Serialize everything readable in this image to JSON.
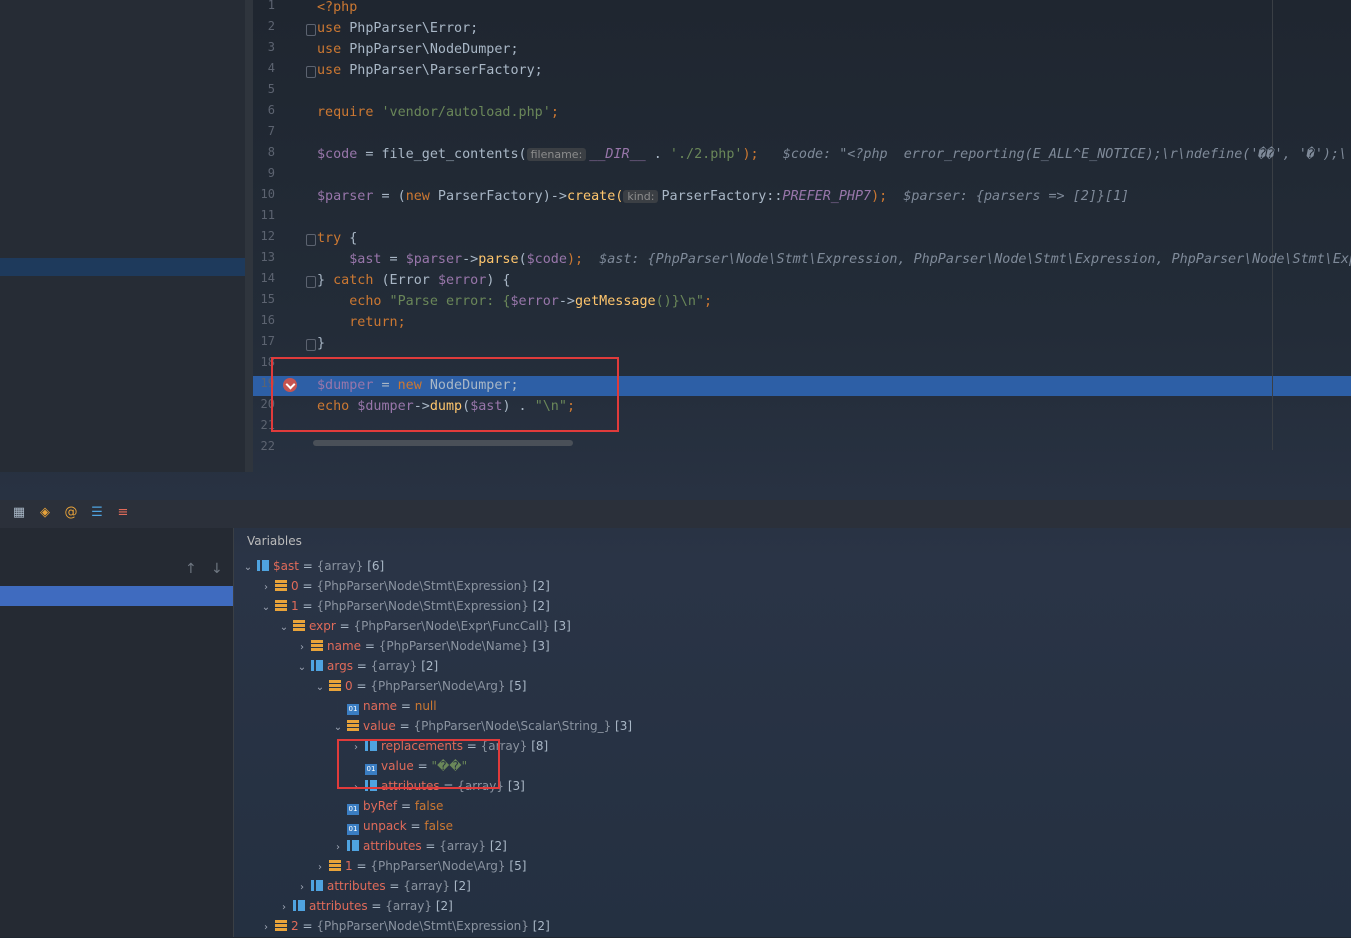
{
  "editor": {
    "line_numbers": [
      "1",
      "2",
      "3",
      "4",
      "5",
      "6",
      "7",
      "8",
      "9",
      "10",
      "11",
      "12",
      "13",
      "14",
      "15",
      "16",
      "17",
      "18",
      "19",
      "20",
      "21",
      "22"
    ],
    "lines": {
      "l1": "<?php",
      "l2_kw": "use",
      "l2_rest": " PhpParser\\Error;",
      "l3_kw": "use",
      "l3_rest": " PhpParser\\NodeDumper;",
      "l4_kw": "use",
      "l4_rest": " PhpParser\\ParserFactory;",
      "l6_kw": "require",
      "l6_str": " 'vendor/autoload.php'",
      "l6_end": ";",
      "l8_var": "$code",
      "l8_a": " = ",
      "l8_fn": "file_get_contents(",
      "l8_hint": "filename:",
      "l8_const": "__DIR__",
      "l8_b": " . ",
      "l8_str": "'./2.php'",
      "l8_c": ");",
      "l8_inline": "$code: \"<?php  error_reporting(E_ALL^E_NOTICE);\\r\\ndefine('\u0000\u0000', '\u0000');\\",
      "l10_var": "$parser",
      "l10_a": " = (",
      "l10_kw": "new",
      "l10_b": " ParserFactory)->",
      "l10_fn": "create(",
      "l10_hint": "kind:",
      "l10_c": "ParserFactory::",
      "l10_const": "PREFER_PHP7",
      "l10_d": ");",
      "l10_inline": "$parser: {parsers => [2]}[1]",
      "l12_kw": "try",
      "l12_rest": " {",
      "l13_var": "$ast",
      "l13_a": " = ",
      "l13_var2": "$parser",
      "l13_b": "->",
      "l13_fn": "parse",
      "l13_c": "(",
      "l13_var3": "$code",
      "l13_d": ");",
      "l13_inline": "$ast: {PhpParser\\Node\\Stmt\\Expression, PhpParser\\Node\\Stmt\\Expression, PhpParser\\Node\\Stmt\\Exp",
      "l14_a": "} ",
      "l14_kw": "catch",
      "l14_b": " (Error ",
      "l14_var": "$error",
      "l14_c": ") {",
      "l15_kw": "echo",
      "l15_str": " \"Parse error: {",
      "l15_var": "$error",
      "l15_b": "->",
      "l15_fn": "getMessage",
      "l15_str2": "()}\\n\"",
      "l15_end": ";",
      "l16_kw": "return",
      "l16_end": ";",
      "l17": "}",
      "l19_var": "$dumper",
      "l19_a": " = ",
      "l19_kw": "new",
      "l19_b": " NodeDumper;",
      "l20_kw": "echo",
      "l20_var": " $dumper",
      "l20_b": "->",
      "l20_fn": "dump",
      "l20_c": "(",
      "l20_var2": "$ast",
      "l20_d": ") . ",
      "l20_str": "\"\\n\"",
      "l20_end": ";"
    }
  },
  "debugger": {
    "variables_title": "Variables",
    "rows": [
      {
        "name": "$ast",
        "type": "{array}",
        "count": "[6]"
      },
      {
        "name": "0",
        "type": "{PhpParser\\Node\\Stmt\\Expression}",
        "count": "[2]"
      },
      {
        "name": "1",
        "type": "{PhpParser\\Node\\Stmt\\Expression}",
        "count": "[2]"
      },
      {
        "name": "expr",
        "type": "{PhpParser\\Node\\Expr\\FuncCall}",
        "count": "[3]"
      },
      {
        "name": "name",
        "type": "{PhpParser\\Node\\Name}",
        "count": "[3]"
      },
      {
        "name": "args",
        "type": "{array}",
        "count": "[2]"
      },
      {
        "name": "0",
        "type": "{PhpParser\\Node\\Arg}",
        "count": "[5]"
      },
      {
        "name": "name",
        "value": "null"
      },
      {
        "name": "value",
        "type": "{PhpParser\\Node\\Scalar\\String_}",
        "count": "[3]"
      },
      {
        "name": "replacements",
        "type": "{array}",
        "count": "[8]"
      },
      {
        "name": "value",
        "value": "\"\u0000\u0000\""
      },
      {
        "name": "attributes",
        "type": "{array}",
        "count": "[3]"
      },
      {
        "name": "byRef",
        "value": "false"
      },
      {
        "name": "unpack",
        "value": "false"
      },
      {
        "name": "attributes",
        "type": "{array}",
        "count": "[2]"
      },
      {
        "name": "1",
        "type": "{PhpParser\\Node\\Arg}",
        "count": "[5]"
      },
      {
        "name": "attributes",
        "type": "{array}",
        "count": "[2]"
      },
      {
        "name": "attributes",
        "type": "{array}",
        "count": "[2]"
      },
      {
        "name": "2",
        "type": "{PhpParser\\Node\\Stmt\\Expression}",
        "count": "[2]"
      }
    ],
    "eq": " = "
  },
  "icons": {
    "toolbar": [
      "table-icon",
      "frames-icon",
      "watch-icon",
      "list-icon",
      "add-watch-icon"
    ],
    "arrows": [
      "up-arrow-icon",
      "down-arrow-icon"
    ]
  },
  "colors": {
    "highlight": "#2d5fa6",
    "box": "#e03b3b",
    "name": "#e06b5a"
  }
}
